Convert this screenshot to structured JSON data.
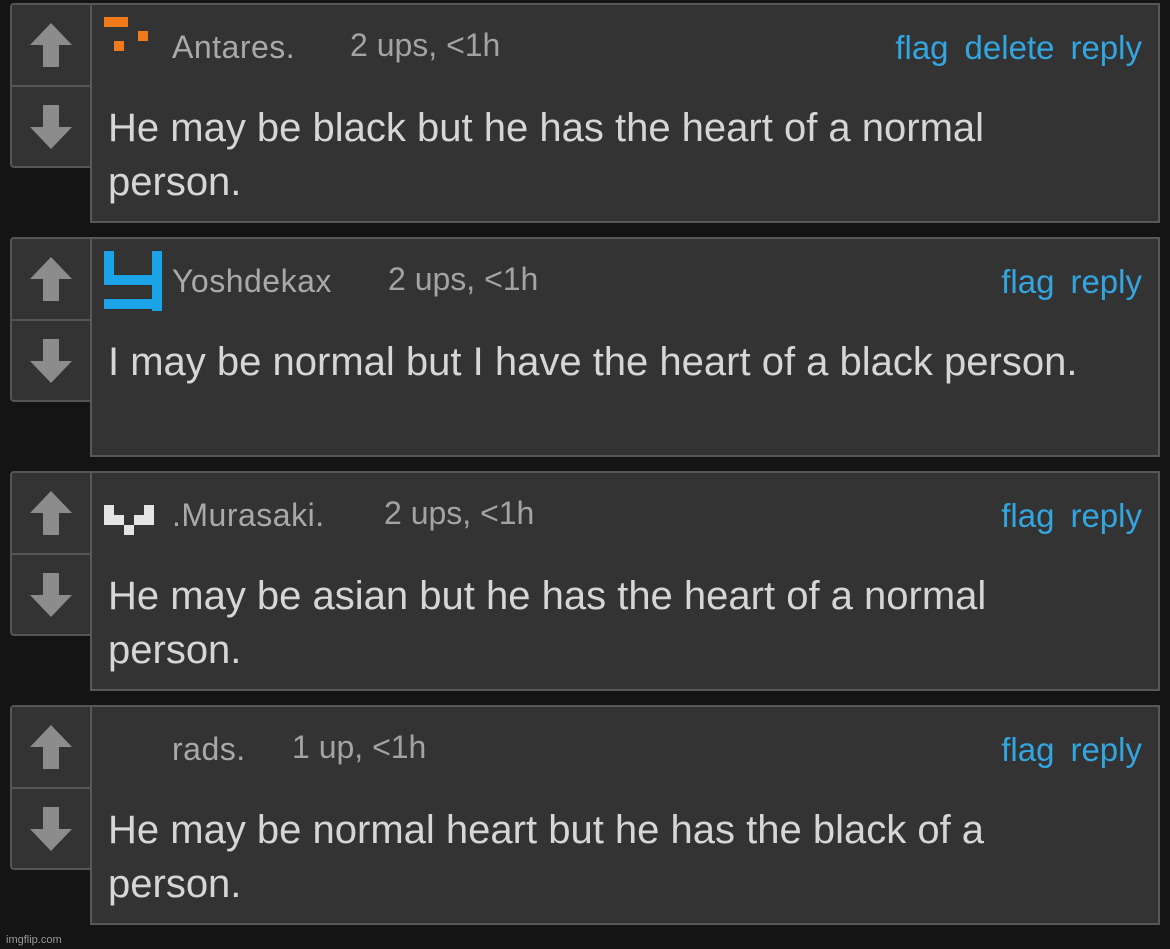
{
  "comments": [
    {
      "username": "Antares.",
      "meta": "2 ups, <1h",
      "actions": [
        "flag",
        "delete",
        "reply"
      ],
      "text": "He may be black but he has the heart of a normal person.",
      "avatar_icon": "orange-pixel-avatar-icon",
      "avatar_color": "#f07a1a"
    },
    {
      "username": "Yoshdekax",
      "meta": "2 ups, <1h",
      "actions": [
        "flag",
        "reply"
      ],
      "text": "I may be normal but I have the heart of a black person.",
      "avatar_icon": "blue-pixel-avatar-icon",
      "avatar_color": "#1aa3e6"
    },
    {
      "username": ".Murasaki.",
      "meta": "2 ups, <1h",
      "actions": [
        "flag",
        "reply"
      ],
      "text": "He may be asian but he has the heart of a normal person.",
      "avatar_icon": "white-pixel-avatar-icon",
      "avatar_color": "#e4e4e4"
    },
    {
      "username": "rads.",
      "meta": "1 up, <1h",
      "actions": [
        "flag",
        "reply"
      ],
      "text": "He may be normal heart but he has the black of a person.",
      "avatar_icon": "",
      "avatar_color": ""
    }
  ],
  "icons": {
    "upvote": "up-arrow-icon",
    "downvote": "down-arrow-icon"
  },
  "colors": {
    "link": "#33a6e0",
    "panel": "#333333",
    "background": "#141414"
  },
  "watermark": "imgflip.com"
}
